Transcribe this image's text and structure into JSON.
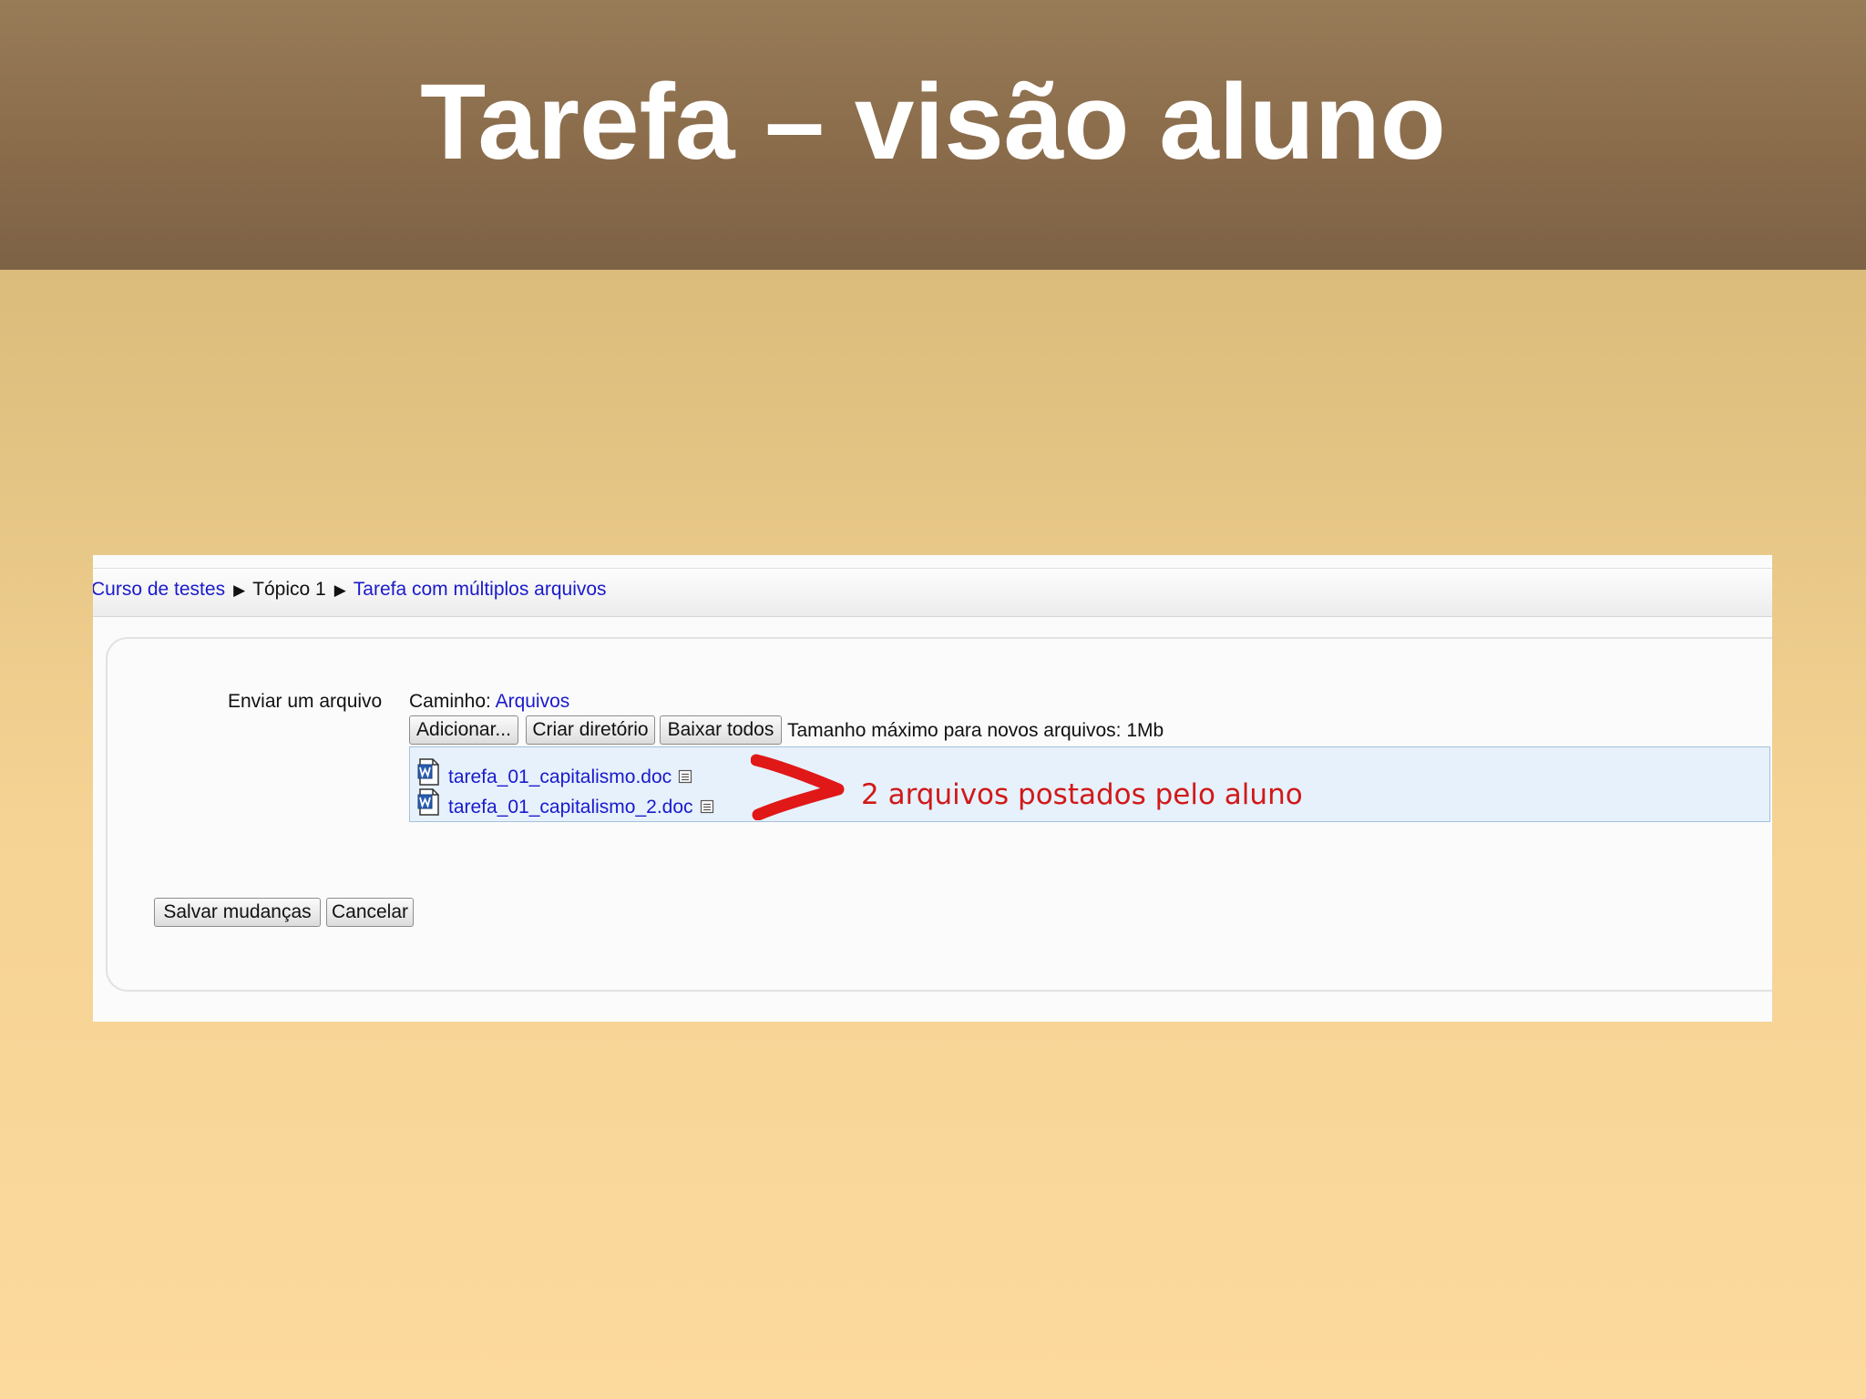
{
  "slide": {
    "title": "Tarefa – visão aluno"
  },
  "breadcrumb": {
    "course": "Curso de testes",
    "separator": "▶",
    "topic": "Tópico 1",
    "assignment": "Tarefa com múltiplos arquivos"
  },
  "form": {
    "field_label": "Enviar um arquivo",
    "path_label": "Caminho:",
    "path_link": "Arquivos",
    "buttons": {
      "add": "Adicionar...",
      "create_dir": "Criar diretório",
      "download_all": "Baixar todos"
    },
    "max_size_text": "Tamanho máximo para novos arquivos: 1Mb",
    "files": [
      {
        "name": "tarefa_01_capitalismo.doc",
        "icon": "word-doc-icon"
      },
      {
        "name": "tarefa_01_capitalismo_2.doc",
        "icon": "word-doc-icon"
      }
    ],
    "save_label": "Salvar mudanças",
    "cancel_label": "Cancelar"
  },
  "annotation": {
    "text": "2 arquivos postados pelo aluno",
    "color": "#d11919"
  },
  "colors": {
    "title_band": "#8a6c4b",
    "link": "#1a1acc",
    "file_list_bg": "#e6f1fb"
  }
}
